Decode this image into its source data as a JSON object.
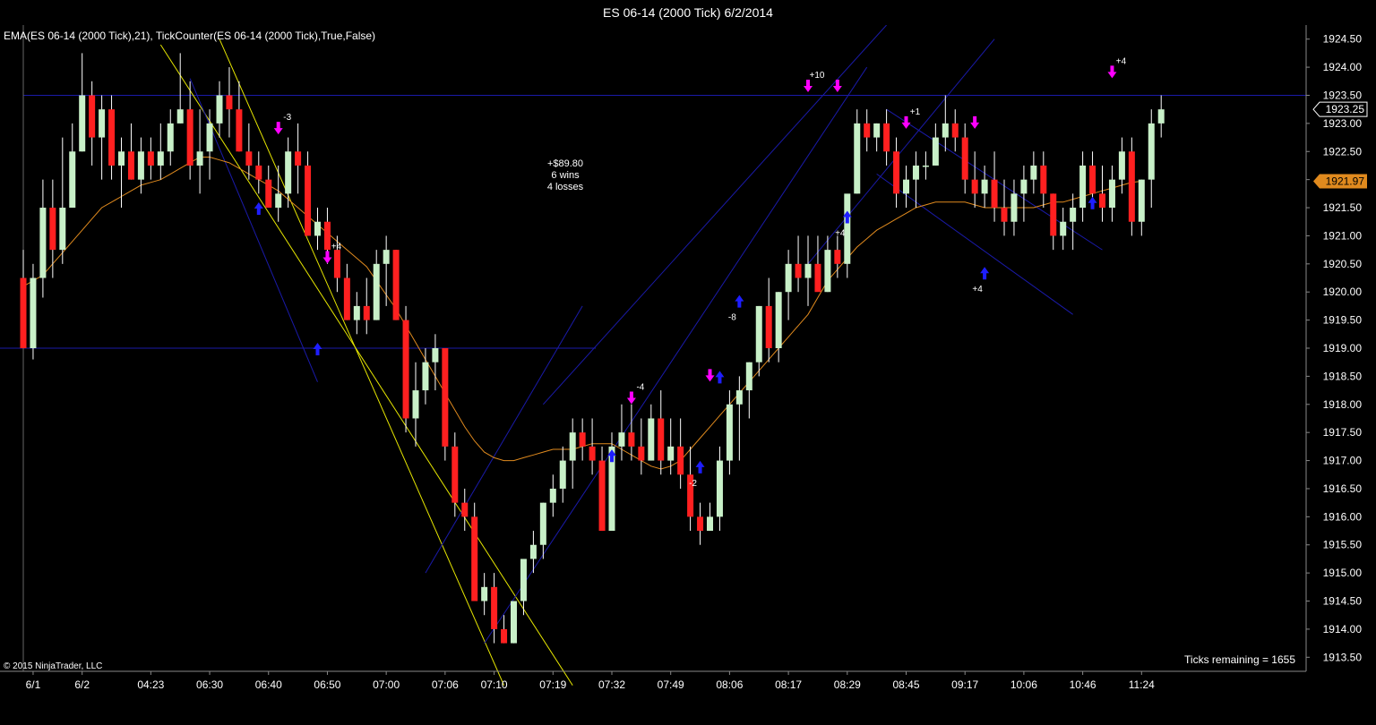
{
  "window": {
    "title": "ES 06-14 (2000 Tick)  6/2/2014"
  },
  "indicator_label": "EMA(ES 06-14 (2000 Tick),21),  TickCounter(ES 06-14 (2000 Tick),True,False)",
  "copyright": "© 2015 NinjaTrader, LLC",
  "ticks_remaining": "Ticks remaining = 1655",
  "summary": {
    "pnl": "+$89.80",
    "wins": "6 wins",
    "losses": "4 losses"
  },
  "colors": {
    "background": "#000000",
    "up_candle": "#c8f0c8",
    "down_candle": "#ff2020",
    "wick": "#ffffff",
    "ema": "#e08a1e",
    "channel": "#1a1aa8",
    "trendline": "#e6e600",
    "buy_arrow": "#1e1eff",
    "sell_arrow": "#ff00ff",
    "axis_text": "#ffffff"
  },
  "chart_data": {
    "type": "candlestick",
    "ylim": [
      1913.25,
      1924.75
    ],
    "y_ticks": [
      "1913.50",
      "1914.00",
      "1914.50",
      "1915.00",
      "1915.50",
      "1916.00",
      "1916.50",
      "1917.00",
      "1917.50",
      "1918.00",
      "1918.50",
      "1919.00",
      "1919.50",
      "1920.00",
      "1920.50",
      "1921.00",
      "1921.50",
      "1922.00",
      "1922.50",
      "1923.00",
      "1923.50",
      "1924.00",
      "1924.50"
    ],
    "x_labels": [
      "6/1",
      "6/2",
      "04:23",
      "06:30",
      "06:40",
      "06:50",
      "07:00",
      "07:06",
      "07:10",
      "07:19",
      "07:32",
      "07:49",
      "08:06",
      "08:17",
      "08:29",
      "08:45",
      "09:17",
      "10:06",
      "10:46",
      "11:24"
    ],
    "x_label_bars": [
      1,
      6,
      13,
      19,
      25,
      31,
      37,
      43,
      48,
      54,
      60,
      66,
      72,
      78,
      84,
      90,
      96,
      102,
      108,
      114
    ],
    "last_price": 1923.25,
    "last_price_label": "1923.25",
    "ema_last": 1921.97,
    "ema_last_label": "1921.97",
    "ema": [
      1920.1,
      1920.2,
      1920.3,
      1920.5,
      1920.7,
      1920.9,
      1921.1,
      1921.3,
      1921.5,
      1921.6,
      1921.7,
      1921.8,
      1921.9,
      1921.95,
      1922.0,
      1922.1,
      1922.2,
      1922.3,
      1922.4,
      1922.4,
      1922.35,
      1922.3,
      1922.2,
      1922.1,
      1922.0,
      1921.9,
      1921.8,
      1921.65,
      1921.5,
      1921.35,
      1921.2,
      1921.05,
      1920.9,
      1920.75,
      1920.6,
      1920.45,
      1920.2,
      1919.95,
      1919.7,
      1919.4,
      1919.1,
      1918.8,
      1918.5,
      1918.2,
      1917.9,
      1917.6,
      1917.35,
      1917.15,
      1917.05,
      1917.0,
      1917.0,
      1917.05,
      1917.1,
      1917.15,
      1917.2,
      1917.2,
      1917.2,
      1917.25,
      1917.3,
      1917.3,
      1917.3,
      1917.2,
      1917.1,
      1917.0,
      1916.9,
      1916.85,
      1916.9,
      1917.0,
      1917.2,
      1917.4,
      1917.6,
      1917.8,
      1918.0,
      1918.2,
      1918.4,
      1918.6,
      1918.8,
      1919.0,
      1919.2,
      1919.4,
      1919.6,
      1919.9,
      1920.2,
      1920.4,
      1920.6,
      1920.8,
      1920.95,
      1921.1,
      1921.2,
      1921.3,
      1921.4,
      1921.5,
      1921.55,
      1921.6,
      1921.6,
      1921.6,
      1921.6,
      1921.55,
      1921.5,
      1921.5,
      1921.5,
      1921.5,
      1921.5,
      1921.5,
      1921.55,
      1921.6,
      1921.6,
      1921.65,
      1921.7,
      1921.75,
      1921.8,
      1921.85,
      1921.9,
      1921.95,
      1921.97
    ],
    "candles": [
      {
        "o": 1920.25,
        "h": 1920.75,
        "l": 1919.0,
        "c": 1919.0
      },
      {
        "o": 1919.0,
        "h": 1920.5,
        "l": 1918.8,
        "c": 1920.25
      },
      {
        "o": 1920.25,
        "h": 1922.0,
        "l": 1919.9,
        "c": 1921.5
      },
      {
        "o": 1921.5,
        "h": 1922.0,
        "l": 1920.25,
        "c": 1920.75
      },
      {
        "o": 1920.75,
        "h": 1922.75,
        "l": 1920.5,
        "c": 1921.5
      },
      {
        "o": 1921.5,
        "h": 1923.0,
        "l": 1921.5,
        "c": 1922.5
      },
      {
        "o": 1922.5,
        "h": 1924.25,
        "l": 1922.5,
        "c": 1923.5
      },
      {
        "o": 1923.5,
        "h": 1923.75,
        "l": 1922.25,
        "c": 1922.75
      },
      {
        "o": 1922.75,
        "h": 1923.5,
        "l": 1922.0,
        "c": 1923.25
      },
      {
        "o": 1923.25,
        "h": 1923.5,
        "l": 1922.0,
        "c": 1922.25
      },
      {
        "o": 1922.25,
        "h": 1922.75,
        "l": 1921.5,
        "c": 1922.5
      },
      {
        "o": 1922.5,
        "h": 1923.0,
        "l": 1922.0,
        "c": 1922.0
      },
      {
        "o": 1922.0,
        "h": 1922.75,
        "l": 1921.75,
        "c": 1922.5
      },
      {
        "o": 1922.5,
        "h": 1922.75,
        "l": 1922.0,
        "c": 1922.25
      },
      {
        "o": 1922.25,
        "h": 1923.0,
        "l": 1922.0,
        "c": 1922.5
      },
      {
        "o": 1922.5,
        "h": 1923.25,
        "l": 1922.25,
        "c": 1923.0
      },
      {
        "o": 1923.0,
        "h": 1924.25,
        "l": 1923.0,
        "c": 1923.25
      },
      {
        "o": 1923.25,
        "h": 1923.75,
        "l": 1922.0,
        "c": 1922.25
      },
      {
        "o": 1922.25,
        "h": 1923.25,
        "l": 1921.75,
        "c": 1922.5
      },
      {
        "o": 1922.5,
        "h": 1923.25,
        "l": 1922.0,
        "c": 1923.0
      },
      {
        "o": 1923.0,
        "h": 1923.75,
        "l": 1922.75,
        "c": 1923.5
      },
      {
        "o": 1923.5,
        "h": 1924.0,
        "l": 1922.75,
        "c": 1923.25
      },
      {
        "o": 1923.25,
        "h": 1923.75,
        "l": 1922.5,
        "c": 1922.5
      },
      {
        "o": 1922.5,
        "h": 1923.0,
        "l": 1922.0,
        "c": 1922.25
      },
      {
        "o": 1922.25,
        "h": 1922.5,
        "l": 1921.75,
        "c": 1922.0
      },
      {
        "o": 1922.0,
        "h": 1922.25,
        "l": 1921.5,
        "c": 1921.5
      },
      {
        "o": 1921.5,
        "h": 1922.25,
        "l": 1921.25,
        "c": 1921.75
      },
      {
        "o": 1921.75,
        "h": 1922.75,
        "l": 1921.5,
        "c": 1922.5
      },
      {
        "o": 1922.5,
        "h": 1923.0,
        "l": 1921.75,
        "c": 1922.25
      },
      {
        "o": 1922.25,
        "h": 1922.5,
        "l": 1921.0,
        "c": 1921.0
      },
      {
        "o": 1921.0,
        "h": 1921.5,
        "l": 1920.75,
        "c": 1921.25
      },
      {
        "o": 1921.25,
        "h": 1921.5,
        "l": 1920.5,
        "c": 1920.75
      },
      {
        "o": 1920.75,
        "h": 1921.0,
        "l": 1920.0,
        "c": 1920.25
      },
      {
        "o": 1920.25,
        "h": 1920.5,
        "l": 1919.5,
        "c": 1919.5
      },
      {
        "o": 1919.5,
        "h": 1920.0,
        "l": 1919.25,
        "c": 1919.75
      },
      {
        "o": 1919.75,
        "h": 1920.25,
        "l": 1919.25,
        "c": 1919.5
      },
      {
        "o": 1919.5,
        "h": 1920.75,
        "l": 1919.5,
        "c": 1920.5
      },
      {
        "o": 1920.5,
        "h": 1921.0,
        "l": 1919.75,
        "c": 1920.75
      },
      {
        "o": 1920.75,
        "h": 1920.75,
        "l": 1919.5,
        "c": 1919.5
      },
      {
        "o": 1919.5,
        "h": 1919.75,
        "l": 1917.5,
        "c": 1917.75
      },
      {
        "o": 1917.75,
        "h": 1918.75,
        "l": 1917.25,
        "c": 1918.25
      },
      {
        "o": 1918.25,
        "h": 1919.0,
        "l": 1918.0,
        "c": 1918.75
      },
      {
        "o": 1918.75,
        "h": 1919.25,
        "l": 1918.25,
        "c": 1919.0
      },
      {
        "o": 1919.0,
        "h": 1919.0,
        "l": 1917.0,
        "c": 1917.25
      },
      {
        "o": 1917.25,
        "h": 1917.5,
        "l": 1916.0,
        "c": 1916.25
      },
      {
        "o": 1916.25,
        "h": 1916.5,
        "l": 1915.75,
        "c": 1916.0
      },
      {
        "o": 1916.0,
        "h": 1916.25,
        "l": 1914.75,
        "c": 1914.5
      },
      {
        "o": 1914.5,
        "h": 1915.0,
        "l": 1914.25,
        "c": 1914.75
      },
      {
        "o": 1914.75,
        "h": 1915.0,
        "l": 1913.75,
        "c": 1914.0
      },
      {
        "o": 1914.0,
        "h": 1914.25,
        "l": 1913.75,
        "c": 1913.75
      },
      {
        "o": 1913.75,
        "h": 1914.5,
        "l": 1913.75,
        "c": 1914.5
      },
      {
        "o": 1914.5,
        "h": 1915.0,
        "l": 1914.25,
        "c": 1915.25
      },
      {
        "o": 1915.25,
        "h": 1915.75,
        "l": 1915.0,
        "c": 1915.5
      },
      {
        "o": 1915.5,
        "h": 1916.25,
        "l": 1915.25,
        "c": 1916.25
      },
      {
        "o": 1916.25,
        "h": 1916.75,
        "l": 1916.0,
        "c": 1916.5
      },
      {
        "o": 1916.5,
        "h": 1917.25,
        "l": 1916.25,
        "c": 1917.0
      },
      {
        "o": 1917.0,
        "h": 1917.75,
        "l": 1916.5,
        "c": 1917.5
      },
      {
        "o": 1917.5,
        "h": 1917.75,
        "l": 1917.0,
        "c": 1917.25
      },
      {
        "o": 1917.25,
        "h": 1917.75,
        "l": 1916.75,
        "c": 1917.0
      },
      {
        "o": 1917.0,
        "h": 1917.25,
        "l": 1915.75,
        "c": 1915.75
      },
      {
        "o": 1915.75,
        "h": 1917.5,
        "l": 1915.75,
        "c": 1917.25
      },
      {
        "o": 1917.25,
        "h": 1918.0,
        "l": 1917.0,
        "c": 1917.5
      },
      {
        "o": 1917.5,
        "h": 1918.0,
        "l": 1917.0,
        "c": 1917.25
      },
      {
        "o": 1917.25,
        "h": 1917.75,
        "l": 1916.75,
        "c": 1917.0
      },
      {
        "o": 1917.0,
        "h": 1918.0,
        "l": 1917.0,
        "c": 1917.75
      },
      {
        "o": 1917.75,
        "h": 1918.25,
        "l": 1916.75,
        "c": 1917.0
      },
      {
        "o": 1917.0,
        "h": 1917.75,
        "l": 1916.75,
        "c": 1917.25
      },
      {
        "o": 1917.25,
        "h": 1917.75,
        "l": 1916.5,
        "c": 1916.75
      },
      {
        "o": 1916.75,
        "h": 1917.25,
        "l": 1915.75,
        "c": 1916.0
      },
      {
        "o": 1916.0,
        "h": 1916.25,
        "l": 1915.5,
        "c": 1915.75
      },
      {
        "o": 1915.75,
        "h": 1916.25,
        "l": 1915.75,
        "c": 1916.0
      },
      {
        "o": 1916.0,
        "h": 1917.25,
        "l": 1915.75,
        "c": 1917.0
      },
      {
        "o": 1917.0,
        "h": 1918.25,
        "l": 1916.75,
        "c": 1918.0
      },
      {
        "o": 1918.0,
        "h": 1918.5,
        "l": 1917.0,
        "c": 1918.25
      },
      {
        "o": 1918.25,
        "h": 1918.75,
        "l": 1917.75,
        "c": 1918.75
      },
      {
        "o": 1918.75,
        "h": 1919.75,
        "l": 1918.5,
        "c": 1919.75
      },
      {
        "o": 1919.75,
        "h": 1920.25,
        "l": 1918.75,
        "c": 1919.0
      },
      {
        "o": 1919.0,
        "h": 1920.0,
        "l": 1918.75,
        "c": 1920.0
      },
      {
        "o": 1920.0,
        "h": 1920.75,
        "l": 1919.5,
        "c": 1920.5
      },
      {
        "o": 1920.5,
        "h": 1921.0,
        "l": 1920.0,
        "c": 1920.25
      },
      {
        "o": 1920.25,
        "h": 1921.0,
        "l": 1919.75,
        "c": 1920.5
      },
      {
        "o": 1920.5,
        "h": 1921.0,
        "l": 1920.25,
        "c": 1920.0
      },
      {
        "o": 1920.0,
        "h": 1921.0,
        "l": 1920.0,
        "c": 1920.75
      },
      {
        "o": 1920.75,
        "h": 1921.0,
        "l": 1920.25,
        "c": 1920.5
      },
      {
        "o": 1920.5,
        "h": 1921.5,
        "l": 1920.25,
        "c": 1921.75
      },
      {
        "o": 1921.75,
        "h": 1923.25,
        "l": 1921.75,
        "c": 1923.0
      },
      {
        "o": 1923.0,
        "h": 1923.25,
        "l": 1922.5,
        "c": 1922.75
      },
      {
        "o": 1922.75,
        "h": 1923.0,
        "l": 1922.5,
        "c": 1923.0
      },
      {
        "o": 1923.0,
        "h": 1923.25,
        "l": 1922.25,
        "c": 1922.5
      },
      {
        "o": 1922.5,
        "h": 1922.75,
        "l": 1921.5,
        "c": 1921.75
      },
      {
        "o": 1921.75,
        "h": 1922.25,
        "l": 1921.5,
        "c": 1922.0
      },
      {
        "o": 1922.0,
        "h": 1922.5,
        "l": 1921.5,
        "c": 1922.25
      },
      {
        "o": 1922.25,
        "h": 1922.5,
        "l": 1922.0,
        "c": 1922.25
      },
      {
        "o": 1922.25,
        "h": 1923.0,
        "l": 1922.25,
        "c": 1922.75
      },
      {
        "o": 1922.75,
        "h": 1923.5,
        "l": 1922.5,
        "c": 1923.0
      },
      {
        "o": 1923.0,
        "h": 1923.25,
        "l": 1922.5,
        "c": 1922.75
      },
      {
        "o": 1922.75,
        "h": 1923.0,
        "l": 1921.75,
        "c": 1922.0
      },
      {
        "o": 1922.0,
        "h": 1922.5,
        "l": 1921.5,
        "c": 1921.75
      },
      {
        "o": 1921.75,
        "h": 1922.25,
        "l": 1921.5,
        "c": 1922.0
      },
      {
        "o": 1922.0,
        "h": 1922.5,
        "l": 1921.25,
        "c": 1921.5
      },
      {
        "o": 1921.5,
        "h": 1922.0,
        "l": 1921.0,
        "c": 1921.25
      },
      {
        "o": 1921.25,
        "h": 1922.0,
        "l": 1921.0,
        "c": 1921.75
      },
      {
        "o": 1921.75,
        "h": 1922.25,
        "l": 1921.25,
        "c": 1922.0
      },
      {
        "o": 1922.0,
        "h": 1922.5,
        "l": 1921.75,
        "c": 1922.25
      },
      {
        "o": 1922.25,
        "h": 1922.5,
        "l": 1921.5,
        "c": 1921.75
      },
      {
        "o": 1921.75,
        "h": 1921.75,
        "l": 1920.75,
        "c": 1921.0
      },
      {
        "o": 1921.0,
        "h": 1921.5,
        "l": 1920.75,
        "c": 1921.25
      },
      {
        "o": 1921.25,
        "h": 1921.75,
        "l": 1920.75,
        "c": 1921.5
      },
      {
        "o": 1921.5,
        "h": 1922.5,
        "l": 1921.25,
        "c": 1922.25
      },
      {
        "o": 1922.25,
        "h": 1922.5,
        "l": 1921.5,
        "c": 1921.75
      },
      {
        "o": 1921.75,
        "h": 1922.25,
        "l": 1921.25,
        "c": 1921.5
      },
      {
        "o": 1921.5,
        "h": 1922.25,
        "l": 1921.25,
        "c": 1922.0
      },
      {
        "o": 1922.0,
        "h": 1922.75,
        "l": 1921.75,
        "c": 1922.5
      },
      {
        "o": 1922.5,
        "h": 1922.75,
        "l": 1921.0,
        "c": 1921.25
      },
      {
        "o": 1921.25,
        "h": 1922.0,
        "l": 1921.0,
        "c": 1922.0
      },
      {
        "o": 1922.0,
        "h": 1923.25,
        "l": 1921.5,
        "c": 1923.0
      },
      {
        "o": 1923.0,
        "h": 1923.5,
        "l": 1922.75,
        "c": 1923.25
      }
    ],
    "horizontal_lines": [
      1923.5,
      1919.0
    ],
    "signals": [
      {
        "bar": 24,
        "type": "buy",
        "price": 1921.5,
        "label": ""
      },
      {
        "bar": 26,
        "type": "sell",
        "price": 1922.9,
        "label": "-3"
      },
      {
        "bar": 31,
        "type": "sell",
        "price": 1920.6,
        "label": "+4"
      },
      {
        "bar": 30,
        "type": "buy",
        "price": 1919.0,
        "label": ""
      },
      {
        "bar": 60,
        "type": "buy",
        "price": 1917.1,
        "label": ""
      },
      {
        "bar": 62,
        "type": "sell",
        "price": 1918.1,
        "label": "-4"
      },
      {
        "bar": 69,
        "type": "buy",
        "price": 1916.9,
        "label": "-2"
      },
      {
        "bar": 70,
        "type": "sell",
        "price": 1918.5,
        "label": ""
      },
      {
        "bar": 71,
        "type": "buy",
        "price": 1918.5,
        "label": ""
      },
      {
        "bar": 73,
        "type": "buy",
        "price": 1919.85,
        "label": "-8"
      },
      {
        "bar": 80,
        "type": "sell",
        "price": 1923.65,
        "label": "+10"
      },
      {
        "bar": 83,
        "type": "sell",
        "price": 1923.65,
        "label": ""
      },
      {
        "bar": 84,
        "type": "buy",
        "price": 1921.35,
        "label": "+4"
      },
      {
        "bar": 90,
        "type": "sell",
        "price": 1923.0,
        "label": "+1"
      },
      {
        "bar": 97,
        "type": "sell",
        "price": 1923.0,
        "label": ""
      },
      {
        "bar": 98,
        "type": "buy",
        "price": 1920.35,
        "label": "+4"
      },
      {
        "bar": 109,
        "type": "buy",
        "price": 1921.6,
        "label": ""
      },
      {
        "bar": 111,
        "type": "sell",
        "price": 1923.9,
        "label": "+4"
      }
    ],
    "trendlines": [
      {
        "color": "yellow",
        "x1": 14,
        "y1": 1924.4,
        "x2": 56,
        "y2": 1913.0
      },
      {
        "color": "yellow",
        "x1": 20,
        "y1": 1924.5,
        "x2": 49,
        "y2": 1913.0
      },
      {
        "color": "channel",
        "x1": 17,
        "y1": 1923.8,
        "x2": 30,
        "y2": 1918.4
      },
      {
        "color": "channel",
        "x1": 41,
        "y1": 1915.0,
        "x2": 57,
        "y2": 1919.75
      },
      {
        "color": "channel",
        "x1": 47,
        "y1": 1913.75,
        "x2": 86,
        "y2": 1924.0
      },
      {
        "color": "channel",
        "x1": 53,
        "y1": 1918.0,
        "x2": 88,
        "y2": 1924.75
      },
      {
        "color": "channel",
        "x1": 80,
        "y1": 1920.5,
        "x2": 99,
        "y2": 1924.5
      },
      {
        "color": "channel",
        "x1": 88,
        "y1": 1923.25,
        "x2": 110,
        "y2": 1920.75
      },
      {
        "color": "channel",
        "x1": 87,
        "y1": 1922.1,
        "x2": 107,
        "y2": 1919.6
      }
    ]
  }
}
